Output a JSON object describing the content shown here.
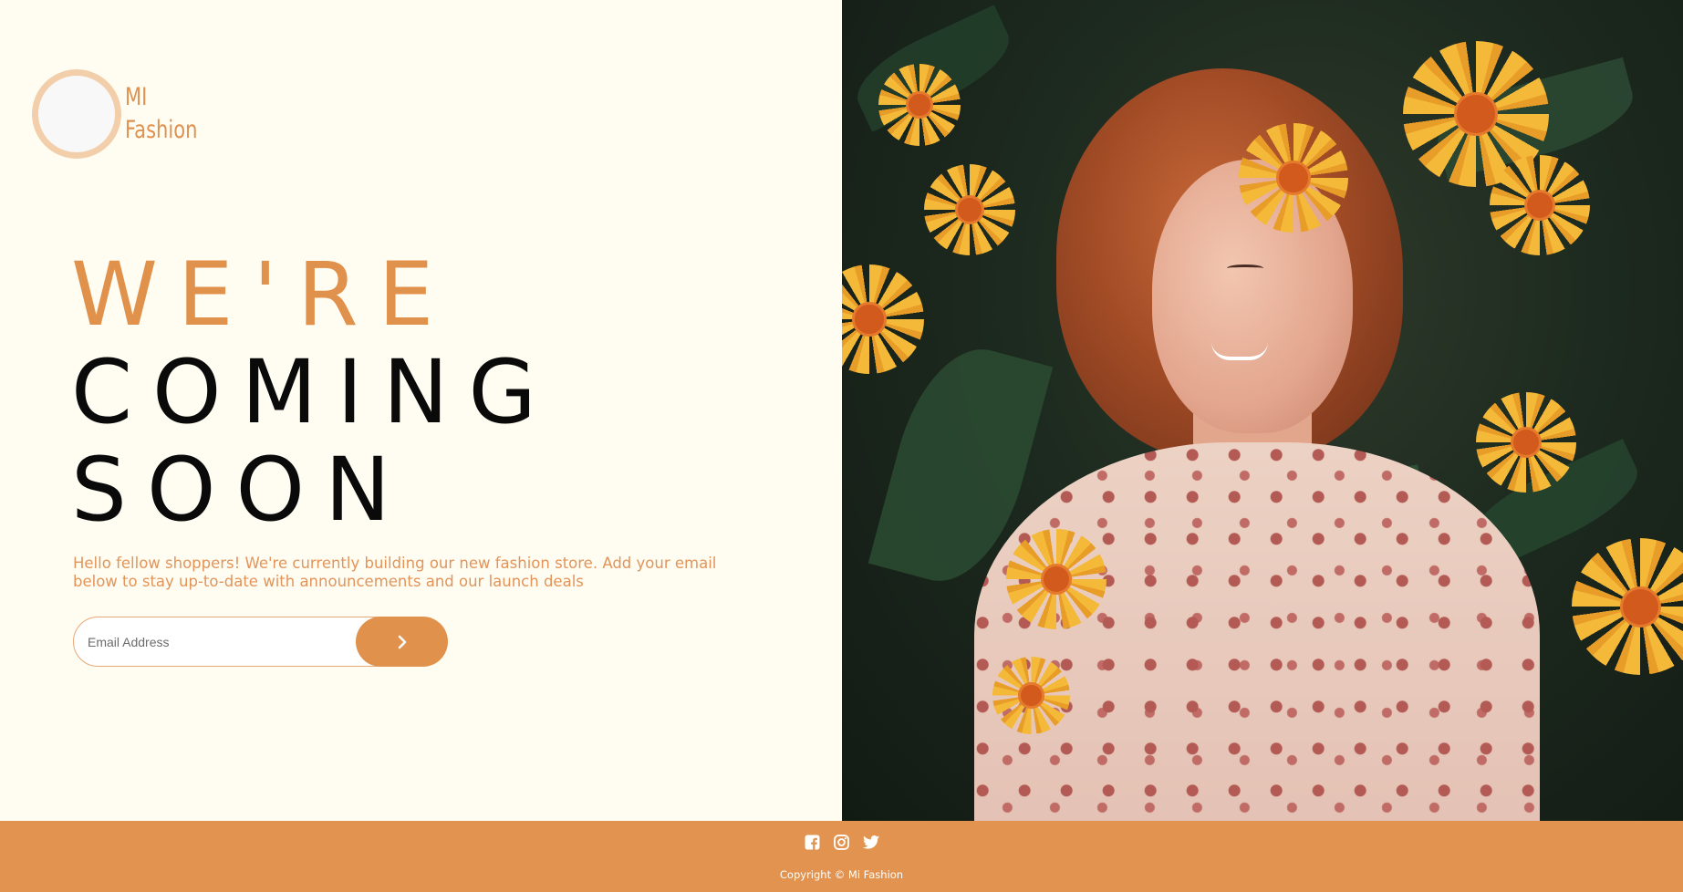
{
  "brand": {
    "line1": "MI",
    "line2": "Fashion"
  },
  "headline": {
    "line1": "WE'RE",
    "line2": "COMING",
    "line3": "SOON"
  },
  "intro": "Hello fellow shoppers! We're currently building our new fashion store. Add your email below to stay up-to-date with announcements and our launch deals",
  "signup": {
    "placeholder": "Email Address",
    "submit_icon": "chevron-right-icon"
  },
  "footer": {
    "social": [
      {
        "name": "facebook-icon"
      },
      {
        "name": "instagram-icon"
      },
      {
        "name": "twitter-icon"
      }
    ],
    "copyright": "Copyright © Mi Fashion"
  },
  "colors": {
    "accent": "#e0924d",
    "background": "#fffdf1",
    "accent_light": "#f2cfaa"
  }
}
